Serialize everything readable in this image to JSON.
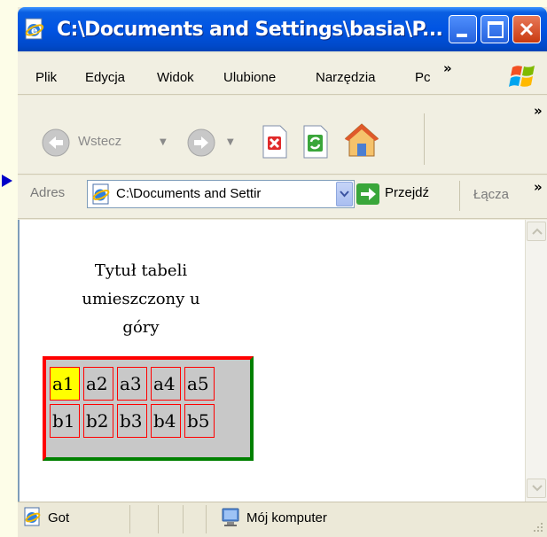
{
  "window": {
    "title": "C:\\Documents and Settings\\basia\\P...",
    "accent": "#0054e3"
  },
  "menu": {
    "items": [
      "Plik",
      "Edycja",
      "Widok",
      "Ulubione",
      "Narzędzia",
      "Pc"
    ],
    "overflow": "»"
  },
  "toolbar": {
    "back_label": "Wstecz",
    "overflow": "»"
  },
  "address": {
    "label": "Adres",
    "value": "C:\\Documents and Settir",
    "go_label": "Przejdź",
    "links_label": "Łącza",
    "overflow": "»"
  },
  "content": {
    "caption_lines": [
      "Tytuł tabeli",
      "umieszczony u",
      "góry"
    ],
    "table": {
      "rows": [
        [
          "a1",
          "a2",
          "a3",
          "a4",
          "a5"
        ],
        [
          "b1",
          "b2",
          "b3",
          "b4",
          "b5"
        ]
      ],
      "highlight_cell": "a1",
      "highlight_color": "#ffff00",
      "cell_bg": "#c8c8c8",
      "border_light": "#ff0000",
      "border_dark": "#008000"
    }
  },
  "status": {
    "text": "Got",
    "zone": "Mój komputer"
  },
  "icons": {
    "pointer": "arrow-right-icon",
    "ie": "ie-page-icon",
    "windows": "windows-flag-icon",
    "back": "back-arrow-icon",
    "forward": "forward-arrow-icon",
    "stop": "stop-icon",
    "refresh": "refresh-icon",
    "home": "home-icon",
    "go": "go-arrow-icon",
    "computer": "my-computer-icon"
  }
}
